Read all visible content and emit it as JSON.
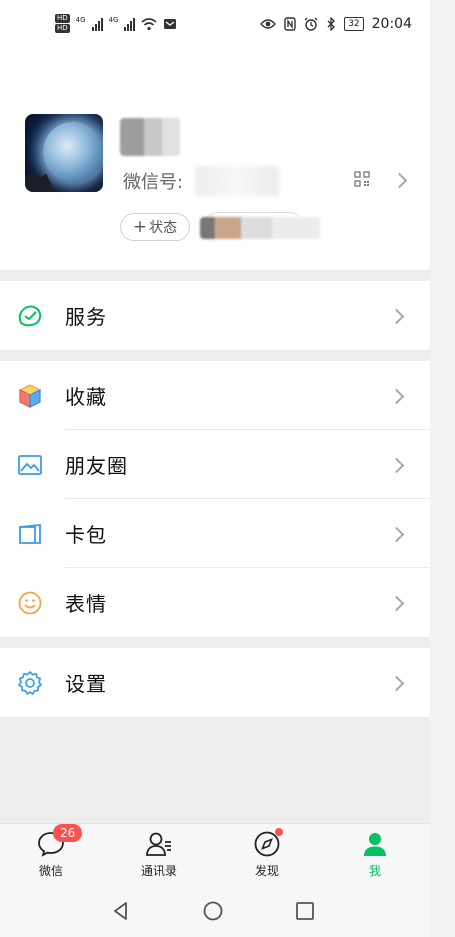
{
  "status_bar": {
    "left_badges": [
      "HD",
      "HD"
    ],
    "sim_labels": [
      "4G",
      "4G"
    ],
    "battery": "32",
    "time": "20:04"
  },
  "profile": {
    "wechat_id_label": "微信号:",
    "status_button_label": "状态",
    "status_plus": "+"
  },
  "menu": {
    "service": {
      "label": "服务",
      "icon": "service-icon"
    },
    "favorites": {
      "label": "收藏",
      "icon": "cube-icon"
    },
    "moments": {
      "label": "朋友圈",
      "icon": "image-icon"
    },
    "cards": {
      "label": "卡包",
      "icon": "card-icon"
    },
    "stickers": {
      "label": "表情",
      "icon": "smiley-icon"
    },
    "settings": {
      "label": "设置",
      "icon": "gear-icon"
    }
  },
  "tabbar": {
    "chats": {
      "label": "微信",
      "badge": "26"
    },
    "contacts": {
      "label": "通讯录"
    },
    "discover": {
      "label": "发现"
    },
    "me": {
      "label": "我"
    }
  },
  "colors": {
    "accent_green": "#07c160",
    "badge_red": "#fa5151"
  }
}
